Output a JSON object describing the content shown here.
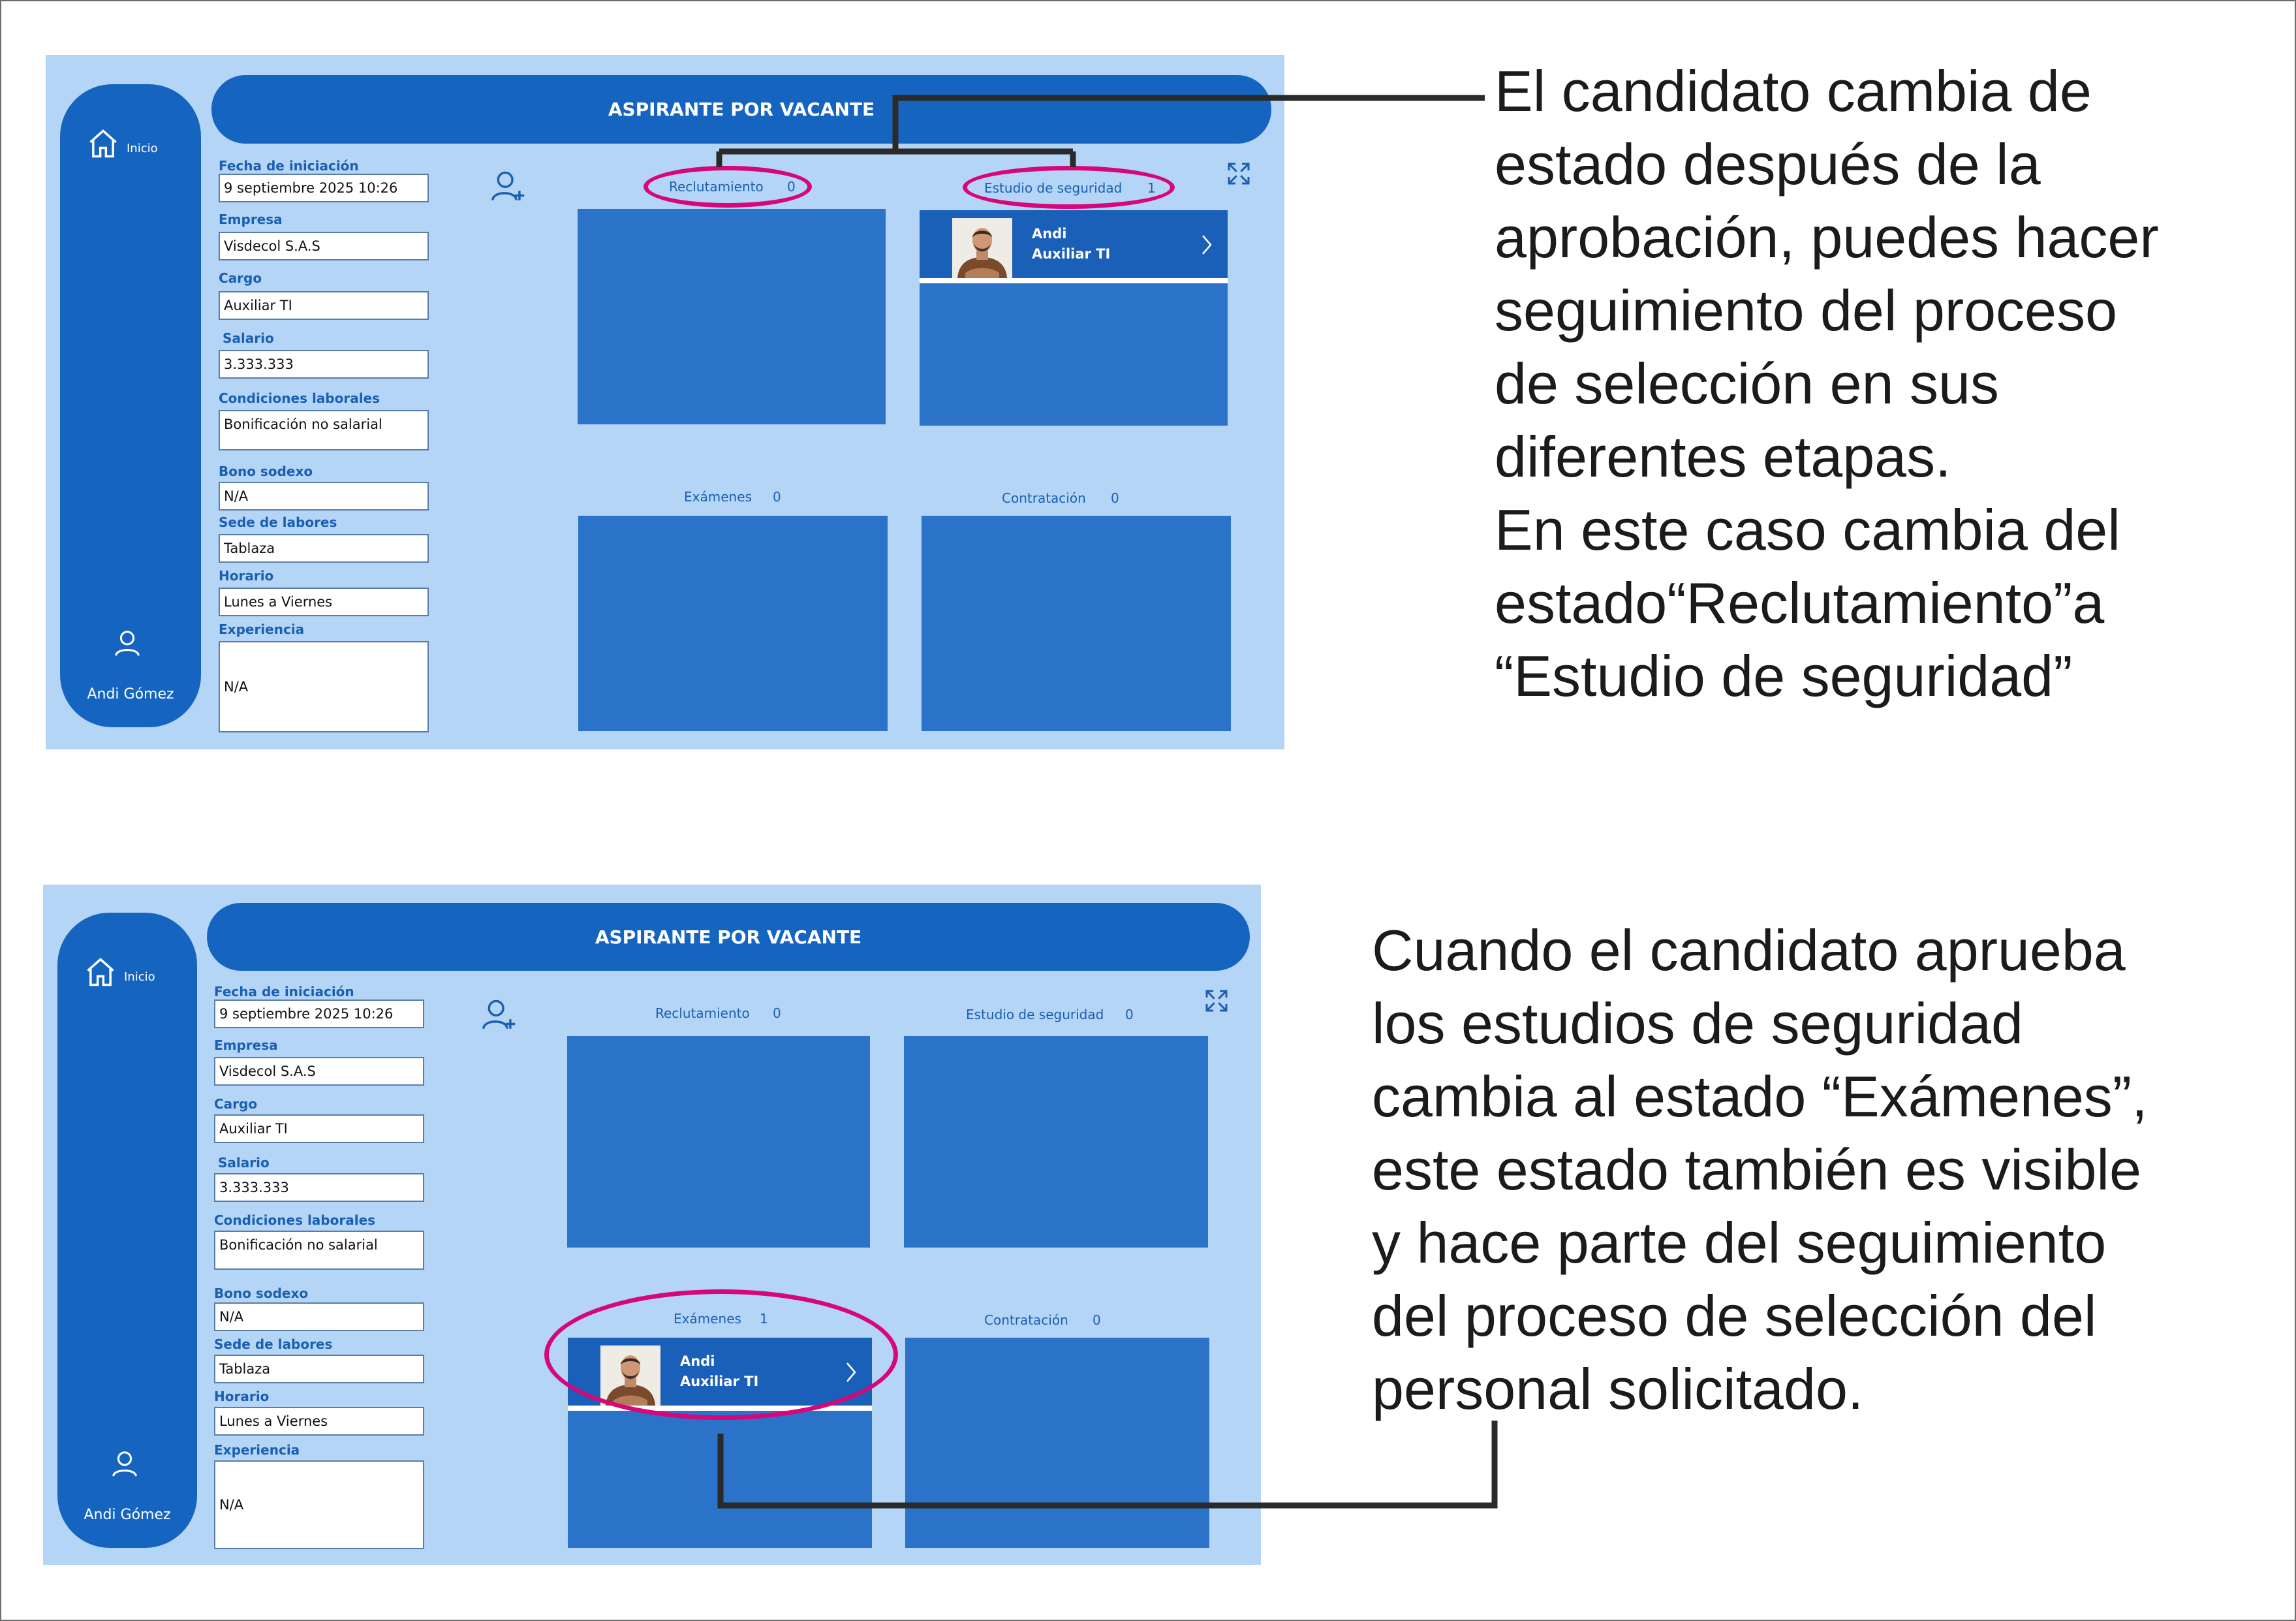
{
  "nav": {
    "home_label": "Inicio",
    "user_name": "Andi Gómez",
    "home_icon": "home-icon",
    "user_icon": "user-icon"
  },
  "header": {
    "title": "ASPIRANTE POR VACANTE"
  },
  "form": {
    "fecha_label": "Fecha de iniciación",
    "fecha_value": "9 septiembre 2025 10:26",
    "empresa_label": "Empresa",
    "empresa_value": "Visdecol S.A.S",
    "cargo_label": "Cargo",
    "cargo_value": "Auxiliar TI",
    "salario_label": "Salario",
    "salario_value": "3.333.333",
    "condiciones_label": "Condiciones laborales",
    "condiciones_value": "Bonificación no salarial",
    "bono_label": "Bono sodexo",
    "bono_value": "N/A",
    "sede_label": "Sede de labores",
    "sede_value": "Tablaza",
    "horario_label": "Horario",
    "horario_value": "Lunes a Viernes",
    "experiencia_label": "Experiencia",
    "experiencia_value": "N/A"
  },
  "screen1": {
    "stages": {
      "reclutamiento": {
        "label": "Reclutamiento",
        "count": "0"
      },
      "estudio": {
        "label": "Estudio de seguridad",
        "count": "1"
      },
      "examenes": {
        "label": "Exámenes",
        "count": "0"
      },
      "contratacion": {
        "label": "Contratación",
        "count": "0"
      }
    },
    "card": {
      "name": "Andi",
      "role": "Auxiliar TI"
    }
  },
  "screen2": {
    "stages": {
      "reclutamiento": {
        "label": "Reclutamiento",
        "count": "0"
      },
      "estudio": {
        "label": "Estudio de seguridad",
        "count": "0"
      },
      "examenes": {
        "label": "Exámenes",
        "count": "1"
      },
      "contratacion": {
        "label": "Contratación",
        "count": "0"
      }
    },
    "card": {
      "name": "Andi",
      "role": "Auxiliar TI"
    }
  },
  "annotations": {
    "note1": [
      "El candidato cambia de",
      "estado después de la",
      "aprobación, puedes hacer",
      "seguimiento del proceso",
      "de selección en sus",
      "diferentes etapas.",
      "En este caso cambia del",
      "estado“Reclutamiento”a",
      "“Estudio de seguridad”"
    ],
    "note2": [
      "Cuando el candidato aprueba",
      "los estudios de seguridad",
      "cambia al estado “Exámenes”,",
      "este estado también es visible",
      "y hace parte del seguimiento",
      "del proceso de selección del",
      "personal solicitado."
    ],
    "highlight_color": "#d6077a",
    "app_blue": "#1565c0",
    "app_background": "#b5d5f7"
  }
}
